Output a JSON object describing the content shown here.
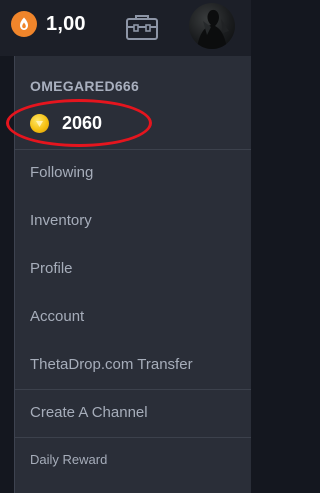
{
  "header": {
    "balance": "1,00",
    "currency_icon": "theta-coin-icon",
    "wallet_icon": "wallet-icon",
    "avatar_icon": "avatar"
  },
  "account": {
    "username": "OMEGARED666",
    "points": "2060",
    "points_icon": "gold-coin-icon"
  },
  "menu": {
    "items": [
      {
        "label": "Following"
      },
      {
        "label": "Inventory"
      },
      {
        "label": "Profile"
      },
      {
        "label": "Account"
      },
      {
        "label": "ThetaDrop.com Transfer"
      },
      {
        "label": "Create A Channel"
      },
      {
        "label": "Daily Reward"
      }
    ]
  },
  "colors": {
    "background": "#14171f",
    "menu_background": "#2a2e38",
    "highlight_circle": "#e5151e",
    "coin_orange": "#f0852b",
    "coin_gold": "#f5c012"
  }
}
